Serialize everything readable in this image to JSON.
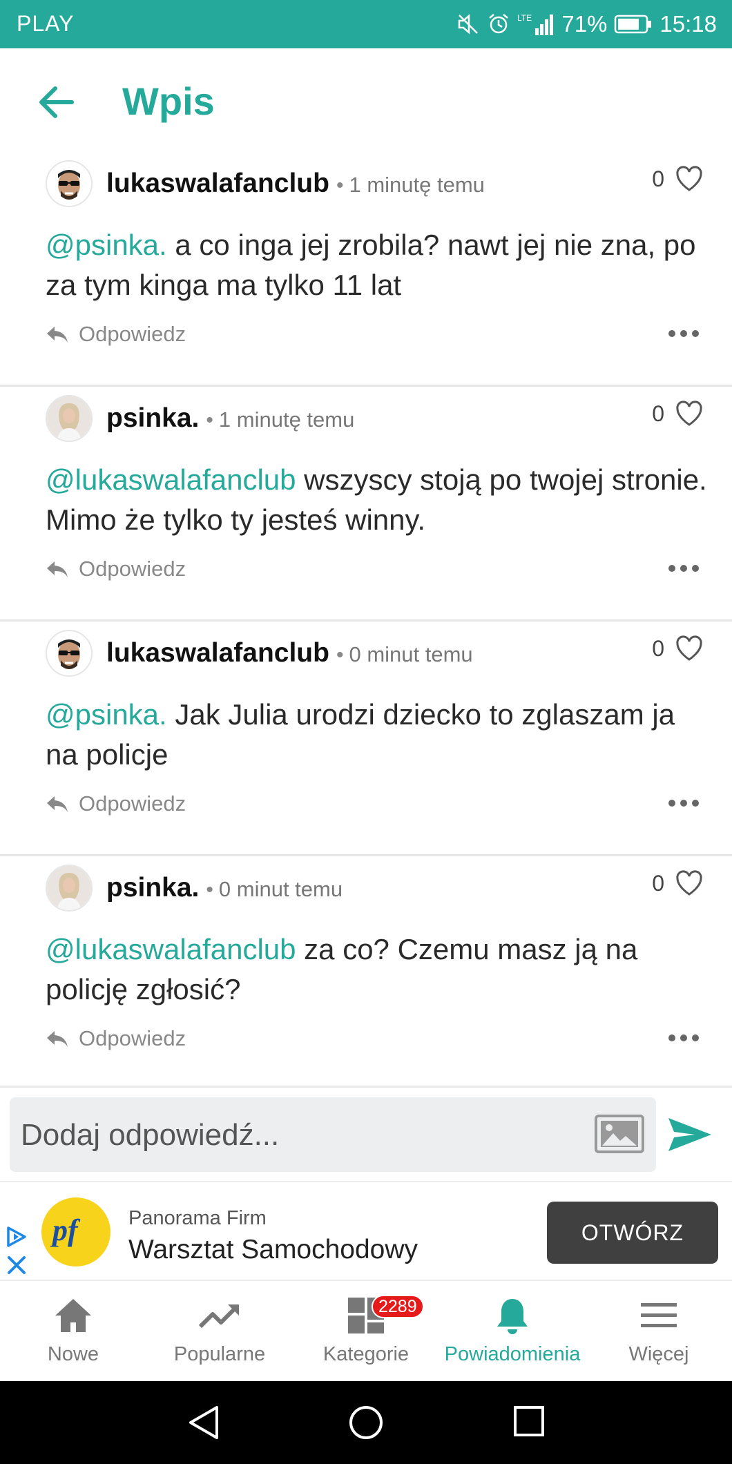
{
  "status_bar": {
    "carrier": "PLAY",
    "battery": "71%",
    "time": "15:18",
    "network": "LTE",
    "icons": [
      "mute-icon",
      "alarm-icon",
      "signal-icon",
      "battery-icon"
    ]
  },
  "header": {
    "title": "Wpis",
    "back_icon": "arrow-left-icon"
  },
  "colors": {
    "accent": "#25a99a",
    "badge": "#e51a1a",
    "cta": "#404040"
  },
  "comments": [
    {
      "username": "lukaswalafanclub",
      "avatar": "sunglasses-face",
      "time": "1 minutę temu",
      "likes": "0",
      "mention": "@psinka.",
      "text": " a co inga jej zrobila? nawt jej nie zna, po za tym kinga ma tylko 11 lat",
      "reply_label": "Odpowiedz"
    },
    {
      "username": "psinka.",
      "avatar": "woman-photo",
      "time": "1 minutę temu",
      "likes": "0",
      "mention": "@lukaswalafanclub",
      "text": " wszyscy stoją po twojej stronie. Mimo że tylko ty jesteś winny.",
      "reply_label": "Odpowiedz"
    },
    {
      "username": "lukaswalafanclub",
      "avatar": "sunglasses-face",
      "time": "0 minut temu",
      "likes": "0",
      "mention": "@psinka.",
      "text": " Jak Julia urodzi dziecko to zglaszam ja na policje",
      "reply_label": "Odpowiedz"
    },
    {
      "username": "psinka.",
      "avatar": "woman-photo",
      "time": "0 minut temu",
      "likes": "0",
      "mention": "@lukaswalafanclub",
      "text": " za co? Czemu masz ją na policję zgłosić?",
      "reply_label": "Odpowiedz"
    }
  ],
  "compose": {
    "placeholder": "Dodaj odpowiedź..."
  },
  "ad": {
    "brand": "Panorama Firm",
    "headline": "Warsztat Samochodowy",
    "cta": "OTWÓRZ",
    "logo_text": "pf"
  },
  "bottom_nav": {
    "items": [
      {
        "label": "Nowe",
        "icon": "home-icon"
      },
      {
        "label": "Popularne",
        "icon": "trending-icon"
      },
      {
        "label": "Kategorie",
        "icon": "grid-icon"
      },
      {
        "label": "Powiadomienia",
        "icon": "bell-icon",
        "active": true,
        "badge": "2289"
      },
      {
        "label": "Więcej",
        "icon": "menu-icon"
      }
    ]
  }
}
